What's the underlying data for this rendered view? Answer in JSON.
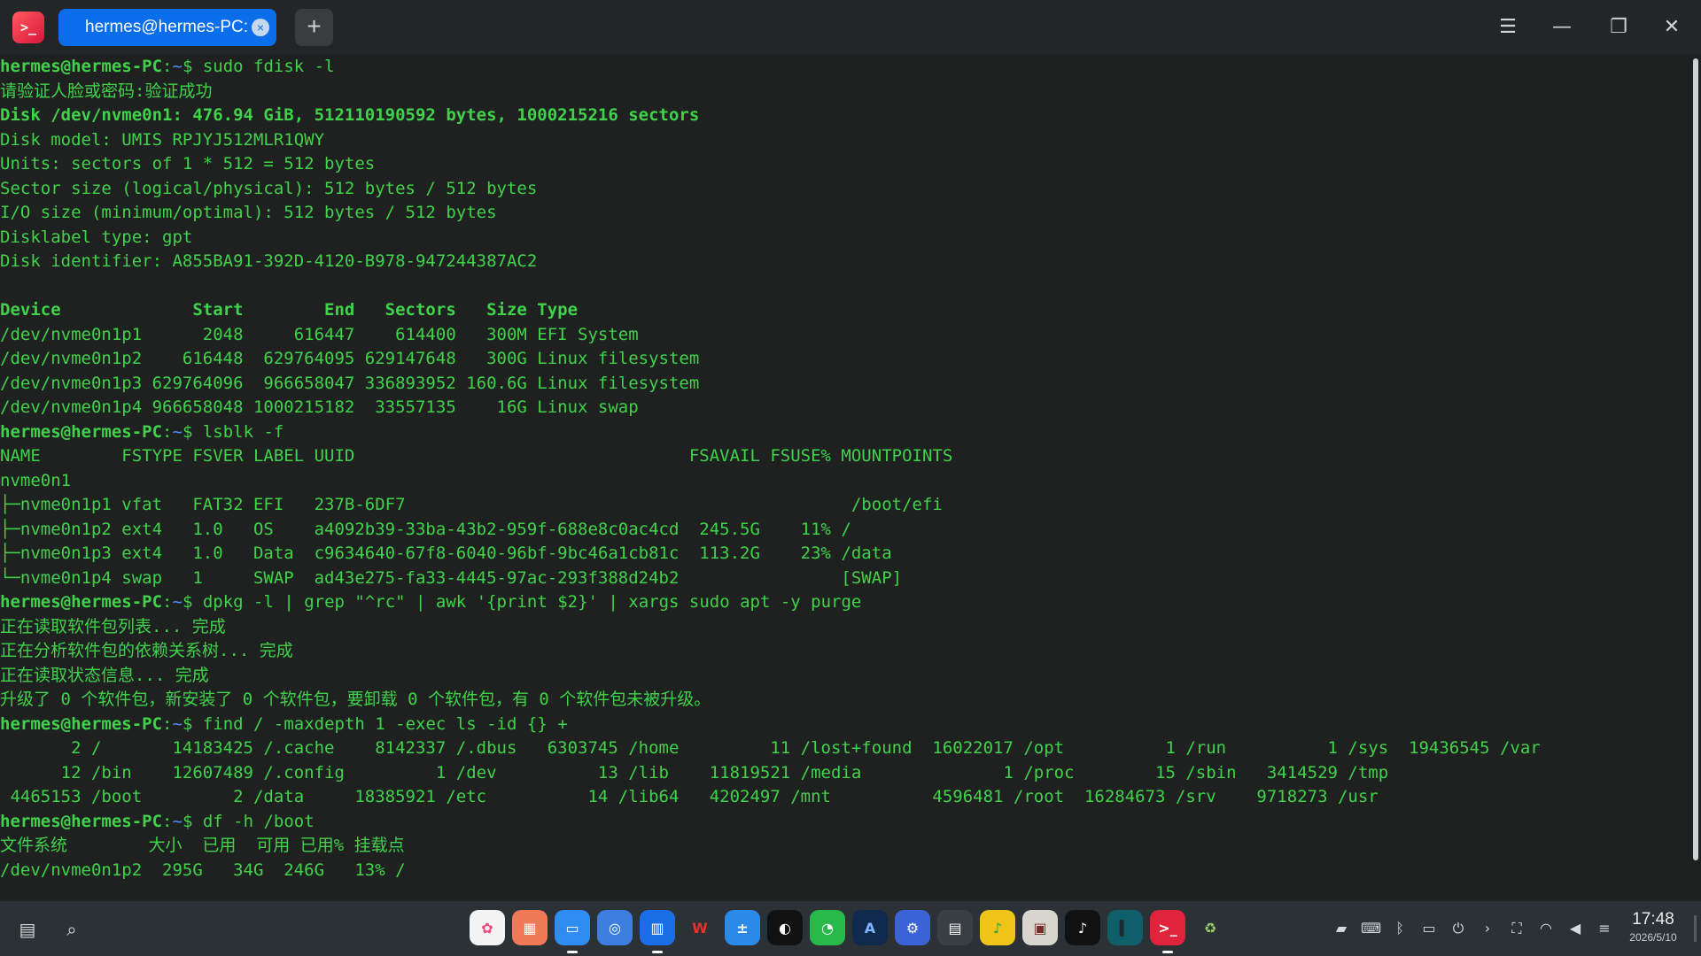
{
  "window": {
    "tab_title": "hermes@hermes-PC: ~",
    "tab_close_glyph": "×",
    "new_tab_glyph": "+",
    "app_icon_glyph": ">_"
  },
  "terminal": {
    "prompt": {
      "user": "hermes@hermes-PC",
      "sep": ":",
      "path": "~",
      "symbol": "$ "
    },
    "commands": [
      "sudo fdisk -l",
      "lsblk -f",
      "dpkg -l | grep \"^rc\" | awk '{print $2}' | xargs sudo apt -y purge",
      "find / -maxdepth 1 -exec ls -id {} +",
      "df -h /boot"
    ],
    "fdisk_output": {
      "auth": "请验证人脸或密码:验证成功",
      "disk_header": "Disk /dev/nvme0n1: 476.94 GiB, 512110190592 bytes, 1000215216 sectors",
      "info": [
        "Disk model: UMIS RPJYJ512MLR1QWY",
        "Units: sectors of 1 * 512 = 512 bytes",
        "Sector size (logical/physical): 512 bytes / 512 bytes",
        "I/O size (minimum/optimal): 512 bytes / 512 bytes",
        "Disklabel type: gpt",
        "Disk identifier: A855BA91-392D-4120-B978-947244387AC2"
      ],
      "table_header": "Device             Start        End   Sectors   Size Type",
      "rows": [
        "/dev/nvme0n1p1      2048     616447    614400   300M EFI System",
        "/dev/nvme0n1p2    616448  629764095 629147648   300G Linux filesystem",
        "/dev/nvme0n1p3 629764096  966658047 336893952 160.6G Linux filesystem",
        "/dev/nvme0n1p4 966658048 1000215182  33557135    16G Linux swap"
      ]
    },
    "lsblk_output": {
      "header": "NAME        FSTYPE FSVER LABEL UUID                                 FSAVAIL FSUSE% MOUNTPOINTS",
      "rows": [
        "nvme0n1",
        "├─nvme0n1p1 vfat   FAT32 EFI   237B-6DF7                                            /boot/efi",
        "├─nvme0n1p2 ext4   1.0   OS    a4092b39-33ba-43b2-959f-688e8c0ac4cd  245.5G    11% /",
        "├─nvme0n1p3 ext4   1.0   Data  c9634640-67f8-6040-96bf-9bc46a1cb81c  113.2G    23% /data",
        "└─nvme0n1p4 swap   1     SWAP  ad43e275-fa33-4445-97ac-293f388d24b2                [SWAP]"
      ]
    },
    "apt_output": [
      "正在读取软件包列表... 完成",
      "正在分析软件包的依赖关系树... 完成",
      "正在读取状态信息... 完成",
      "升级了 0 个软件包，新安装了 0 个软件包，要卸载 0 个软件包，有 0 个软件包未被升级。"
    ],
    "find_output": [
      "       2 /       14183425 /.cache    8142337 /.dbus   6303745 /home         11 /lost+found  16022017 /opt          1 /run          1 /sys  19436545 /var",
      "      12 /bin    12607489 /.config         1 /dev          13 /lib    11819521 /media              1 /proc        15 /sbin   3414529 /tmp",
      " 4465153 /boot         2 /data     18385921 /etc          14 /lib64   4202497 /mnt          4596481 /root  16284673 /srv    9718273 /usr"
    ],
    "df_output": {
      "header": "文件系统        大小  已用  可用 已用% 挂载点",
      "row": "/dev/nvme0n1p2  295G   34G  246G   13% /"
    }
  },
  "taskbar": {
    "left_icons": [
      "clipboard-icon",
      "search-icon"
    ],
    "dock_apps": [
      {
        "name": "launcher",
        "color": "#f4f4f4",
        "glyph": "✿",
        "fg": "#e8467c"
      },
      {
        "name": "app-store",
        "color": "#f07a55",
        "glyph": "▦",
        "fg": "#ffffff"
      },
      {
        "name": "file-manager",
        "color": "#2f8cf0",
        "glyph": "▭",
        "fg": "#ffffff",
        "running": true
      },
      {
        "name": "browser",
        "color": "#3d7fe0",
        "glyph": "◎",
        "fg": "#ffffff"
      },
      {
        "name": "tasks",
        "color": "#1a6fe6",
        "glyph": "▥",
        "fg": "#ffffff",
        "running": true
      },
      {
        "name": "wps",
        "color": "#2b3135",
        "glyph": "W",
        "fg": "#e8332a"
      },
      {
        "name": "calculator",
        "color": "#2a8ae8",
        "glyph": "±",
        "fg": "#ffffff"
      },
      {
        "name": "qq",
        "color": "#111111",
        "glyph": "◐",
        "fg": "#ffffff"
      },
      {
        "name": "wechat",
        "color": "#29b94b",
        "glyph": "◔",
        "fg": "#ffffff"
      },
      {
        "name": "editor",
        "color": "#0e2a4c",
        "glyph": "A",
        "fg": "#7fb6ff"
      },
      {
        "name": "settings",
        "color": "#3a63d8",
        "glyph": "⚙",
        "fg": "#ffffff"
      },
      {
        "name": "printer",
        "color": "#3a3f43",
        "glyph": "▤",
        "fg": "#ffffff"
      },
      {
        "name": "music",
        "color": "#f0c419",
        "glyph": "♪",
        "fg": "#1aa34a"
      },
      {
        "name": "archive",
        "color": "#d9d6d0",
        "glyph": "▣",
        "fg": "#7b2a2a"
      },
      {
        "name": "tiktok",
        "color": "#111111",
        "glyph": "♪",
        "fg": "#ffffff"
      },
      {
        "name": "terminal-alt",
        "color": "#0f5f6a",
        "glyph": "▍",
        "fg": "#1c2c30"
      },
      {
        "name": "terminal",
        "color": "#e0243c",
        "glyph": ">_",
        "fg": "#ffffff",
        "running": true
      },
      {
        "name": "trash",
        "color": "#2b3135",
        "glyph": "♻",
        "fg": "#9bd06a"
      }
    ],
    "tray_icons": [
      "gpu-icon",
      "keyboard-icon",
      "bluetooth-icon",
      "battery-icon",
      "power-icon",
      "chevron-icon",
      "screenshot-icon",
      "wifi-icon",
      "volume-icon",
      "notification-icon"
    ],
    "clock": {
      "time": "17:48",
      "date": "2026/5/10"
    }
  }
}
